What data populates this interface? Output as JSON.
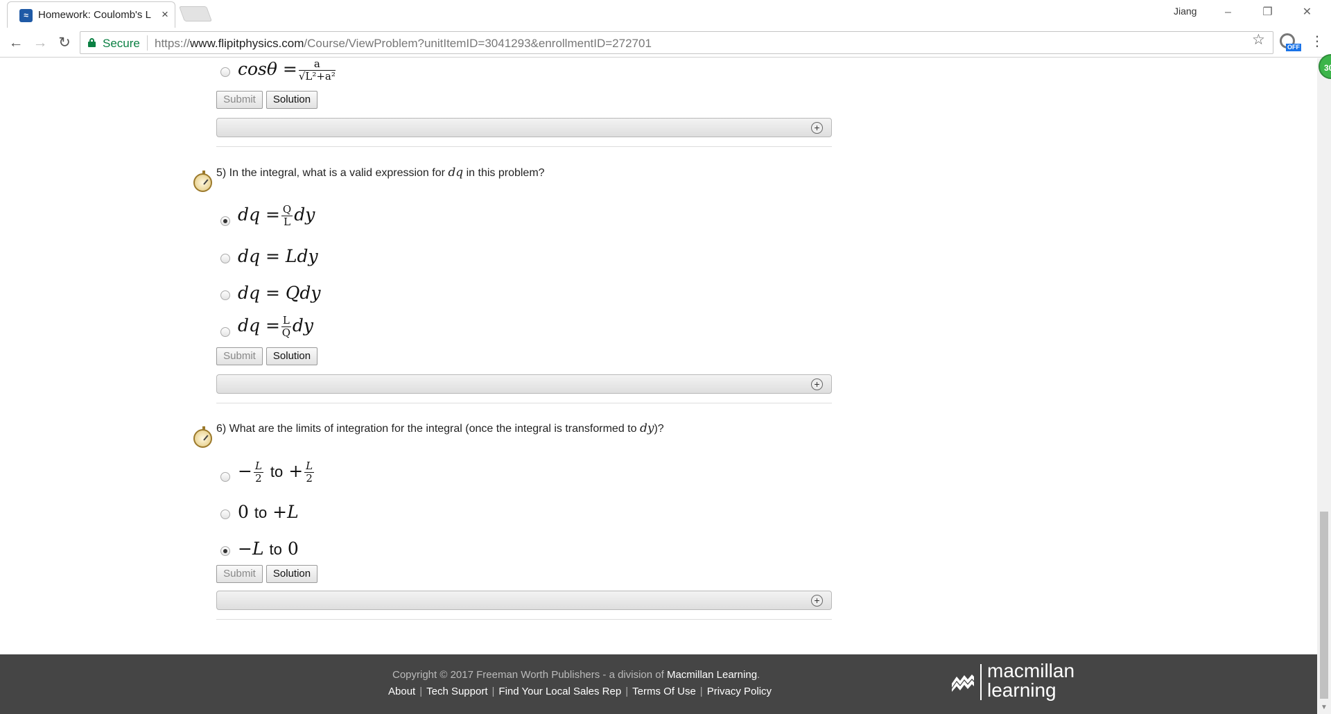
{
  "browser": {
    "tab_title": "Homework: Coulomb's L",
    "user_name": "Jiang",
    "secure_label": "Secure",
    "url_scheme": "https://",
    "url_host": "www.flipitphysics.com",
    "url_path": "/Course/ViewProblem?unitItemID=3041293&enrollmentID=272701",
    "extension_badge": "OFF",
    "timer_badge": "30"
  },
  "buttons": {
    "submit": "Submit",
    "solution": "Solution"
  },
  "question4": {
    "visible_option": {
      "lhs": "cosθ =",
      "num": "a",
      "den": "√L²+a²",
      "checked": false
    }
  },
  "question5": {
    "prompt_before": "5) In the integral, what is a valid expression for ",
    "prompt_var": "dq",
    "prompt_after": " in this problem?",
    "options": [
      {
        "lhs": "dq =",
        "num": "Q",
        "den": "L",
        "rhs": "dy",
        "checked": true
      },
      {
        "text": "dq = Ldy",
        "checked": false
      },
      {
        "text": "dq = Qdy",
        "checked": false
      },
      {
        "lhs": "dq =",
        "num": "L",
        "den": "Q",
        "rhs": "dy",
        "checked": false
      }
    ]
  },
  "question6": {
    "prompt_before": "6) What are the limits of integration for the integral (once the integral is transformed to ",
    "prompt_var": "dy",
    "prompt_after": ")?",
    "options": [
      {
        "sign1": "−",
        "num1": "L",
        "den1": "2",
        "word": "to",
        "sign2": "+",
        "num2": "L",
        "den2": "2",
        "checked": false
      },
      {
        "a": "0",
        "word": "to",
        "b": "+L",
        "checked": false
      },
      {
        "a": "−L",
        "word": "to",
        "b": "0",
        "checked": true
      }
    ]
  },
  "footer": {
    "copyright_prefix": "Copyright © 2017 Freeman Worth Publishers - a division of ",
    "copyright_brand": "Macmillan Learning",
    "copyright_suffix": ".",
    "links": [
      "About",
      "Tech Support",
      "Find Your Local Sales Rep",
      "Terms Of Use",
      "Privacy Policy"
    ],
    "logo_line1": "macmillan",
    "logo_line2": "learning"
  }
}
